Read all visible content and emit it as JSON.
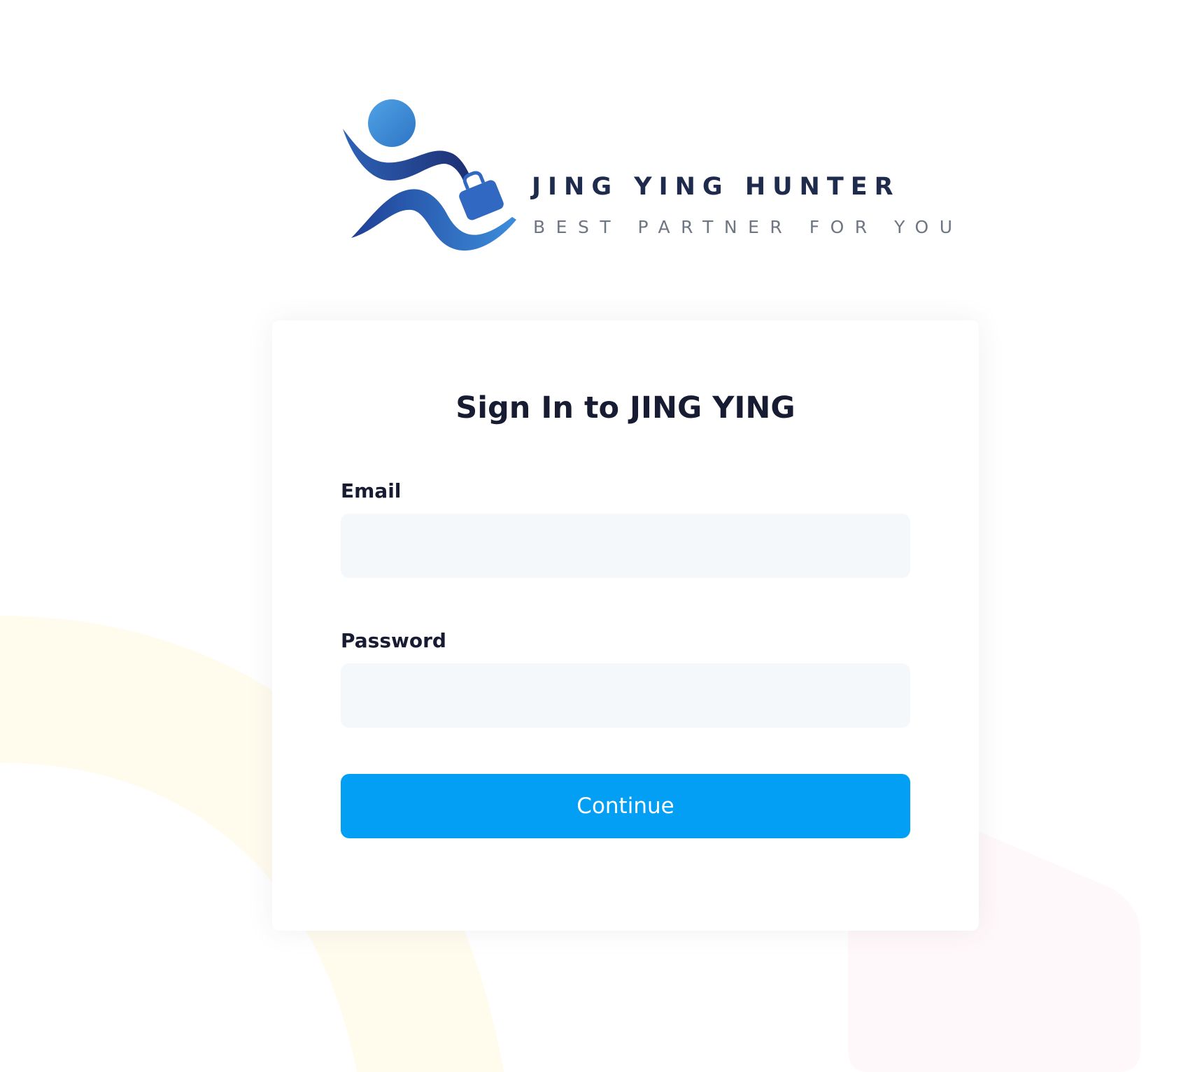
{
  "brand": {
    "name": "JING YING HUNTER",
    "tagline": "BEST PARTNER FOR YOU"
  },
  "login": {
    "title": "Sign In to JING YING",
    "email_label": "Email",
    "email_value": "",
    "password_label": "Password",
    "password_value": "",
    "submit_label": "Continue"
  },
  "icons": {
    "logo": "running-person-with-briefcase-icon"
  },
  "colors": {
    "primary": "#039ff4",
    "input_background": "#f5f8fa",
    "heading": "#181c32",
    "logo_blue": "#3b8fd6",
    "logo_navy": "#1f3f8f",
    "background_decor_yellow": "#fffcee",
    "background_decor_pink": "#fff8fa"
  }
}
